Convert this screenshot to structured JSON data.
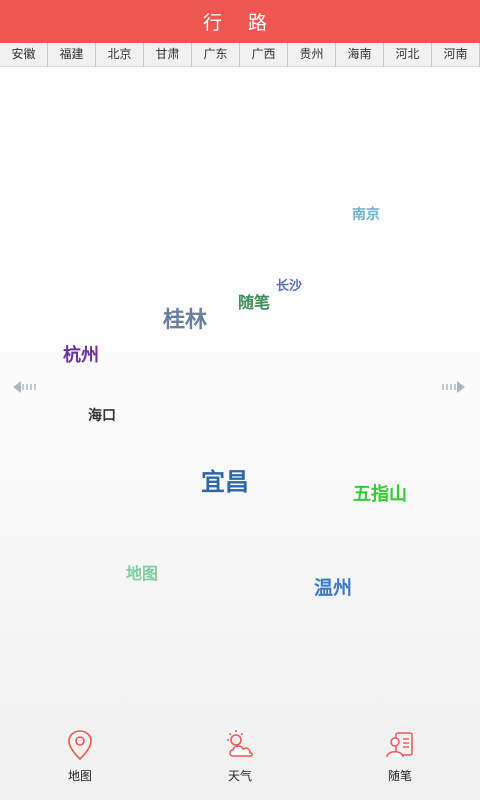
{
  "header": {
    "title": "行 路"
  },
  "provinces": [
    "安徽",
    "福建",
    "北京",
    "甘肃",
    "广东",
    "广西",
    "贵州",
    "海南",
    "河北",
    "河南"
  ],
  "cloud": {
    "words": [
      {
        "text": "南京",
        "color": "#6fb3c8"
      },
      {
        "text": "长沙",
        "color": "#5a6fb8"
      },
      {
        "text": "随笔",
        "color": "#3d8f5a"
      },
      {
        "text": "桂林",
        "color": "#6a7f9a"
      },
      {
        "text": "杭州",
        "color": "#6a2f9a"
      },
      {
        "text": "海口",
        "color": "#333333"
      },
      {
        "text": "宜昌",
        "color": "#2c67a8"
      },
      {
        "text": "五指山",
        "color": "#33cc33"
      },
      {
        "text": "地图",
        "color": "#7fcca0"
      },
      {
        "text": "温州",
        "color": "#3a78c8"
      }
    ]
  },
  "nav": {
    "map_label": "地图",
    "weather_label": "天气",
    "notes_label": "随笔",
    "icon_color": "#ef5652"
  }
}
